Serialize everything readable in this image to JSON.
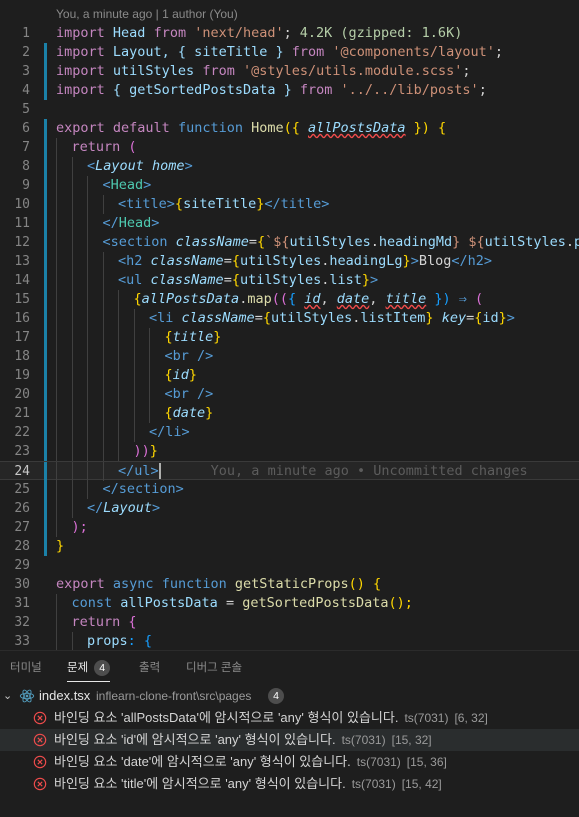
{
  "codelens": "You, a minute ago | 1 author (You)",
  "inline_blame": "You, a minute ago • Uncommitted changes",
  "line_numbers": [
    "1",
    "2",
    "3",
    "4",
    "5",
    "6",
    "7",
    "8",
    "9",
    "10",
    "11",
    "12",
    "13",
    "14",
    "15",
    "16",
    "17",
    "18",
    "19",
    "20",
    "21",
    "22",
    "23",
    "24",
    "25",
    "26",
    "27",
    "28",
    "29",
    "30",
    "31",
    "32",
    "33"
  ],
  "current_line": "24",
  "import_cost": "4.2K (gzipped: 1.6K)",
  "code": {
    "l1": {
      "k1": "import",
      "id": " Head ",
      "k2": "from",
      "s": " 'next/head'",
      "p": ";"
    },
    "l2": {
      "k1": "import",
      "t1": " Layout, { siteTitle } ",
      "k2": "from",
      "s": " '@components/layout'",
      "p": ";"
    },
    "l3": {
      "k1": "import",
      "t1": " utilStyles ",
      "k2": "from",
      "s": " '@styles/utils.module.scss'",
      "p": ";"
    },
    "l4": {
      "k1": "import",
      "t1": " { getSortedPostsData } ",
      "k2": "from",
      "s": " '../../lib/posts'",
      "p": ";"
    },
    "l6": {
      "k1": "export",
      "k2": " default",
      "k3": " function",
      "fn": " Home",
      "b": "({ ",
      "param": "allPostsData",
      "e": " }) {"
    },
    "l7": {
      "k1": "return",
      "p": " ("
    },
    "l8": {
      "o": "<",
      "tag": "Layout",
      "attr": " home",
      "c": ">"
    },
    "l9": {
      "o": "<",
      "tag": "Head",
      "c": ">"
    },
    "l10": {
      "o": "<",
      "tag": "title",
      "c": ">",
      "b1": "{",
      "id": "siteTitle",
      "b2": "}",
      "o2": "</",
      "tag2": "title",
      "c2": ">"
    },
    "l11": {
      "o": "</",
      "tag": "Head",
      "c": ">"
    },
    "l12": {
      "o": "<",
      "tag": "section",
      "attr": " className",
      "eq": "=",
      "b1": "{",
      "s1": "`${",
      "id1": "utilStyles",
      "d1": ".",
      "id2": "headingMd",
      "s2": "} ${",
      "id3": "utilStyles",
      "d2": ".",
      "id4": "padd"
    },
    "l13": {
      "o": "<",
      "tag": "h2",
      "attr": " className",
      "eq": "=",
      "b1": "{",
      "id1": "utilStyles",
      "d": ".",
      "id2": "headingLg",
      "b2": "}",
      "c": ">",
      "txt": "Blog",
      "o2": "</",
      "tag2": "h2",
      "c2": ">"
    },
    "l14": {
      "o": "<",
      "tag": "ul",
      "attr": " className",
      "eq": "=",
      "b1": "{",
      "id1": "utilStyles",
      "d": ".",
      "id2": "list",
      "b2": "}",
      "c": ">"
    },
    "l15": {
      "b1": "{",
      "param": "allPostsData",
      "d": ".",
      "fn": "map",
      "p1": "((",
      "p2": "{ ",
      "a1": "id",
      ",1": ", ",
      "a2": "date",
      ",2": ", ",
      "a3": "title",
      "p3": " })",
      "arrow": " ⇒ ",
      "p4": "("
    },
    "l16": {
      "o": "<",
      "tag": "li",
      "attr": " className",
      "eq": "=",
      "b1": "{",
      "id1": "utilStyles",
      "d": ".",
      "id2": "listItem",
      "b2": "}",
      "attr2": " key",
      "eq2": "=",
      "b3": "{",
      "id3": "id",
      "b4": "}",
      "c": ">"
    },
    "l17": {
      "b1": "{",
      "id": "title",
      "b2": "}"
    },
    "l18": {
      "o": "<",
      "tag": "br",
      "c": " />"
    },
    "l19": {
      "b1": "{",
      "id": "id",
      "b2": "}"
    },
    "l20": {
      "o": "<",
      "tag": "br",
      "c": " />"
    },
    "l21": {
      "b1": "{",
      "id": "date",
      "b2": "}"
    },
    "l22": {
      "o": "</",
      "tag": "li",
      "c": ">"
    },
    "l23": {
      "p1": "))",
      "p2": "}"
    },
    "l24": {
      "o": "</",
      "tag": "ul",
      "c": ">"
    },
    "l25": {
      "o": "</",
      "tag": "section",
      "c": ">"
    },
    "l26": {
      "o": "</",
      "tag": "Layout",
      "c": ">"
    },
    "l27": {
      "p": ");"
    },
    "l28": {
      "p": "}"
    },
    "l30": {
      "k1": "export",
      "k2": " async",
      "k3": " function",
      "fn": " getStaticProps",
      "p": "()",
      "b": " {"
    },
    "l31": {
      "k1": "const",
      "id": " allPostsData ",
      "eq": "=",
      "fn": " getSortedPostsData",
      "p": "();"
    },
    "l32": {
      "k1": "return",
      "p": " {"
    },
    "l33": {
      "id": "props",
      "p": ": {"
    }
  },
  "panel": {
    "tabs": [
      {
        "label": "터미널"
      },
      {
        "label": "문제",
        "count": "4"
      },
      {
        "label": "출력"
      },
      {
        "label": "디버그 콘솔"
      }
    ],
    "file": {
      "name": "index.tsx",
      "path": "inflearn-clone-front\\src\\pages",
      "count": "4"
    },
    "problems": [
      {
        "message": "바인딩 요소 'allPostsData'에 암시적으로 'any' 형식이 있습니다.",
        "source": "ts(7031)",
        "location": "[6, 32]"
      },
      {
        "message": "바인딩 요소 'id'에 암시적으로 'any' 형식이 있습니다.",
        "source": "ts(7031)",
        "location": "[15, 32]"
      },
      {
        "message": "바인딩 요소 'date'에 암시적으로 'any' 형식이 있습니다.",
        "source": "ts(7031)",
        "location": "[15, 36]"
      },
      {
        "message": "바인딩 요소 'title'에 암시적으로 'any' 형식이 있습니다.",
        "source": "ts(7031)",
        "location": "[15, 42]"
      }
    ]
  },
  "colors": {
    "error": "#f14c4c",
    "gutter_modified": "#1b81a8",
    "gutter_added": "#487e02"
  }
}
